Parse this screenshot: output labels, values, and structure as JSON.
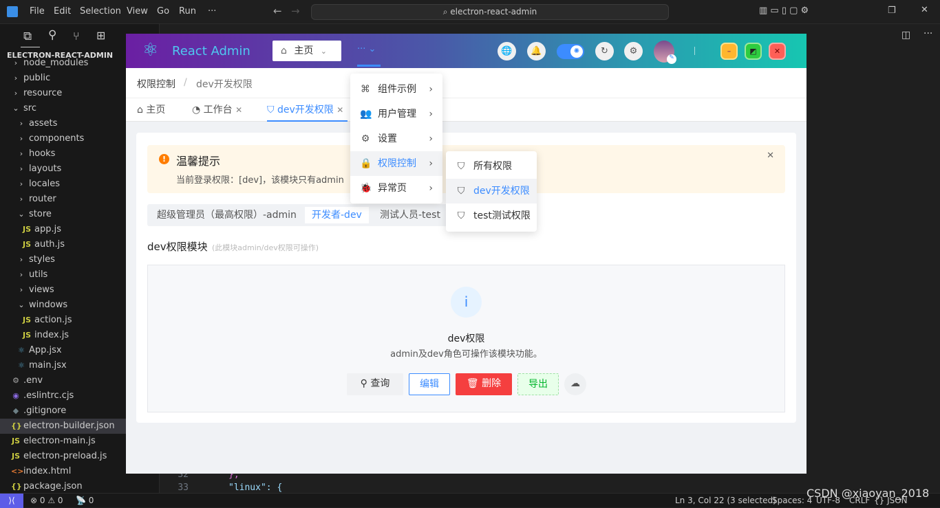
{
  "vscode": {
    "menu": [
      "File",
      "Edit",
      "Selection",
      "View",
      "Go",
      "Run",
      "···"
    ],
    "search": "electron-react-admin",
    "explorer_title": "ELECTRON-REACT-ADMIN",
    "tree": [
      {
        "label": "node_modules",
        "type": "folder",
        "open": false,
        "indent": 0
      },
      {
        "label": "public",
        "type": "folder",
        "open": false,
        "indent": 0
      },
      {
        "label": "resource",
        "type": "folder",
        "open": false,
        "indent": 0
      },
      {
        "label": "src",
        "type": "folder",
        "open": true,
        "indent": 0
      },
      {
        "label": "assets",
        "type": "folder",
        "open": false,
        "indent": 1
      },
      {
        "label": "components",
        "type": "folder",
        "open": false,
        "indent": 1
      },
      {
        "label": "hooks",
        "type": "folder",
        "open": false,
        "indent": 1
      },
      {
        "label": "layouts",
        "type": "folder",
        "open": false,
        "indent": 1
      },
      {
        "label": "locales",
        "type": "folder",
        "open": false,
        "indent": 1
      },
      {
        "label": "router",
        "type": "folder",
        "open": false,
        "indent": 1
      },
      {
        "label": "store",
        "type": "folder",
        "open": true,
        "indent": 1
      },
      {
        "label": "app.js",
        "type": "js",
        "indent": 2
      },
      {
        "label": "auth.js",
        "type": "js",
        "indent": 2
      },
      {
        "label": "styles",
        "type": "folder",
        "open": false,
        "indent": 1
      },
      {
        "label": "utils",
        "type": "folder",
        "open": false,
        "indent": 1
      },
      {
        "label": "views",
        "type": "folder",
        "open": false,
        "indent": 1
      },
      {
        "label": "windows",
        "type": "folder",
        "open": true,
        "indent": 1
      },
      {
        "label": "action.js",
        "type": "js",
        "indent": 2
      },
      {
        "label": "index.js",
        "type": "js",
        "indent": 2
      },
      {
        "label": "App.jsx",
        "type": "jsx",
        "indent": 1
      },
      {
        "label": "main.jsx",
        "type": "jsx",
        "indent": 1
      },
      {
        "label": ".env",
        "type": "gear",
        "indent": 0
      },
      {
        "label": ".eslintrc.cjs",
        "type": "eslint",
        "indent": 0
      },
      {
        "label": ".gitignore",
        "type": "git",
        "indent": 0
      },
      {
        "label": "electron-builder.json",
        "type": "json",
        "indent": 0,
        "selected": true
      },
      {
        "label": "electron-main.js",
        "type": "js",
        "indent": 0
      },
      {
        "label": "electron-preload.js",
        "type": "js",
        "indent": 0
      },
      {
        "label": "index.html",
        "type": "html",
        "indent": 0
      },
      {
        "label": "package.json",
        "type": "json",
        "indent": 0
      }
    ],
    "code": [
      {
        "n": "32",
        "text": "},"
      },
      {
        "n": "33",
        "text": "\"linux\": {"
      }
    ],
    "status": {
      "errors": "0",
      "warnings": "0",
      "ports": "0",
      "position": "Ln 3, Col 22 (3 selected)",
      "spaces": "Spaces: 4",
      "encoding": "UTF-8",
      "eol": "CRLF",
      "language": "{} JSON"
    },
    "watermark": "CSDN @xiaoyan_2018"
  },
  "app": {
    "logo": "React Admin",
    "home_button": "主页",
    "more": "···",
    "breadcrumb": [
      "权限控制",
      "dev开发权限"
    ],
    "tabs": [
      {
        "label": "主页",
        "closable": false
      },
      {
        "label": "工作台",
        "closable": true
      },
      {
        "label": "dev开发权限",
        "closable": true,
        "active": true
      }
    ],
    "alert": {
      "title": "温馨提示",
      "text": "当前登录权限：[dev]，该模块只有admin"
    },
    "segments": [
      "超级管理员（最高权限）-admin",
      "开发者-dev",
      "测试人员-test"
    ],
    "active_segment": 1,
    "module_title": "dev权限模块",
    "module_hint": "(此模块admin/dev权限可操作)",
    "result": {
      "icon": "i",
      "title": "dev权限",
      "desc": "admin及dev角色可操作该模块功能。"
    },
    "buttons": {
      "query": "查询",
      "edit": "编辑",
      "delete": "删除",
      "export": "导出"
    },
    "menu": [
      {
        "label": "组件示例",
        "icon": "⌘"
      },
      {
        "label": "用户管理",
        "icon": "👥"
      },
      {
        "label": "设置",
        "icon": "⚙"
      },
      {
        "label": "权限控制",
        "icon": "🔒",
        "active": true
      },
      {
        "label": "异常页",
        "icon": "🐞"
      }
    ],
    "submenu": [
      {
        "label": "所有权限"
      },
      {
        "label": "dev开发权限",
        "active": true
      },
      {
        "label": "test测试权限"
      }
    ],
    "colors": {
      "primary": "#3c8cff",
      "danger": "#f53f3f",
      "success": "#00b42a",
      "warning": "#ff7d00"
    }
  }
}
